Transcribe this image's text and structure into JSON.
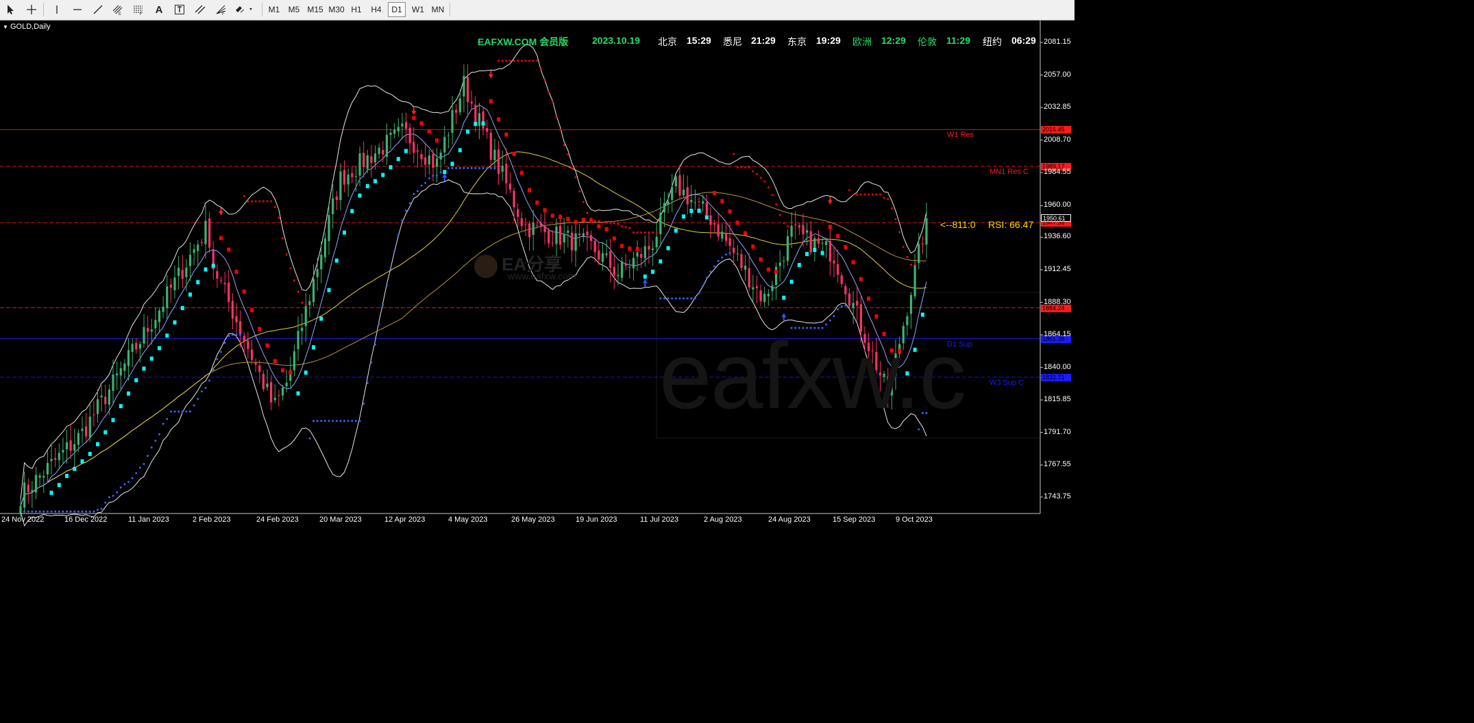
{
  "toolbar": {
    "tools": [
      "cursor-icon",
      "crosshair-icon",
      "vertical-line-icon",
      "horizontal-line-icon",
      "trendline-icon",
      "equidistant-channel-icon",
      "fibonacci-icon",
      "text-icon",
      "text-label-icon",
      "parallel-lines-icon",
      "fibonacci-fan-icon",
      "shapes-icon"
    ],
    "text_tool": "A",
    "timeframes": [
      "M1",
      "M5",
      "M15",
      "M30",
      "H1",
      "H4",
      "D1",
      "W1",
      "MN"
    ],
    "active_timeframe": "D1"
  },
  "chart": {
    "symbol_label": "GOLD,Daily",
    "brand": "EAFXW.COM 会员版",
    "date": "2023.10.19",
    "clocks": [
      {
        "city": "北京",
        "time": "15:29",
        "color": "#ffffff"
      },
      {
        "city": "悉尼",
        "time": "21:29",
        "color": "#ffffff"
      },
      {
        "city": "东京",
        "time": "19:29",
        "color": "#ffffff"
      },
      {
        "city": "欧洲",
        "time": "12:29",
        "color": "#22dd66"
      },
      {
        "city": "伦敦",
        "time": "11:29",
        "color": "#22dd66"
      },
      {
        "city": "纽约",
        "time": "06:29",
        "color": "#ffffff"
      }
    ],
    "watermark_logo": "EA分享",
    "watermark_url": "www.eafxw.com",
    "watermark_big": "eafxw.c",
    "rsi_arrow": "<--811:0",
    "rsi_text": "RSI: 66.47",
    "levels": [
      {
        "name": "W1 Res",
        "price": 2016.45,
        "tag": "2016.45",
        "color": "#ff1a1a",
        "style": "solid"
      },
      {
        "name": "MN1 Res C",
        "price": 1989.17,
        "tag": "1989.17",
        "color": "#ff1a1a",
        "style": "dash"
      },
      {
        "name": "",
        "price": 1947.38,
        "tag": "1947.38",
        "color": "#ff1a1a",
        "style": "dash"
      },
      {
        "name": "",
        "price": 1884.24,
        "tag": "1884.24",
        "color": "#ff1a1a",
        "style": "dash"
      },
      {
        "name": "D1 Sup",
        "price": 1861.38,
        "tag": "1861.38",
        "color": "#1a1aff",
        "style": "solid"
      },
      {
        "name": "W3 Sup C",
        "price": 1832.71,
        "tag": "1832.71",
        "color": "#1a1aff",
        "style": "dash"
      }
    ],
    "current_price_tag": "1950.61",
    "y_ticks": [
      "2081.15",
      "2057.00",
      "2032.85",
      "2008.70",
      "1984.55",
      "1960.00",
      "1936.60",
      "1912.45",
      "1888.30",
      "1864.15",
      "1840.00",
      "1815.85",
      "1791.70",
      "1767.55",
      "1743.75"
    ],
    "x_ticks": [
      "24 Nov 2022",
      "16 Dec 2022",
      "11 Jan 2023",
      "2 Feb 2023",
      "24 Feb 2023",
      "20 Mar 2023",
      "12 Apr 2023",
      "4 May 2023",
      "26 May 2023",
      "19 Jun 2023",
      "11 Jul 2023",
      "2 Aug 2023",
      "24 Aug 2023",
      "15 Sep 2023",
      "9 Oct 2023"
    ],
    "colors": {
      "bull": "#3cb371",
      "bear": "#ff3366",
      "cyan": "#00ffff",
      "red": "#ff0000",
      "blue": "#3366ff",
      "band": "#e8e8e8",
      "ma_yellow": "#e6d23c",
      "ma_slow": "#b8963c",
      "ma_fast": "#8fa8ff"
    }
  },
  "chart_data": {
    "type": "candlestick",
    "symbol": "GOLD",
    "timeframe": "Daily",
    "ylim": [
      1735,
      2090
    ],
    "x_range": [
      "2022-11-24",
      "2023-10-19"
    ],
    "close_path": [
      [
        "2022-11-24",
        1745
      ],
      [
        "2022-12-16",
        1790
      ],
      [
        "2023-01-11",
        1875
      ],
      [
        "2023-01-31",
        1945
      ],
      [
        "2023-02-02",
        1915
      ],
      [
        "2023-02-24",
        1810
      ],
      [
        "2023-03-01",
        1830
      ],
      [
        "2023-03-20",
        1980
      ],
      [
        "2023-04-12",
        2015
      ],
      [
        "2023-04-24",
        1990
      ],
      [
        "2023-05-04",
        2050
      ],
      [
        "2023-05-12",
        2010
      ],
      [
        "2023-05-26",
        1945
      ],
      [
        "2023-06-19",
        1930
      ],
      [
        "2023-06-29",
        1910
      ],
      [
        "2023-07-11",
        1930
      ],
      [
        "2023-07-20",
        1975
      ],
      [
        "2023-08-02",
        1950
      ],
      [
        "2023-08-21",
        1890
      ],
      [
        "2023-08-31",
        1940
      ],
      [
        "2023-09-15",
        1925
      ],
      [
        "2023-10-05",
        1820
      ],
      [
        "2023-10-19",
        1950
      ]
    ],
    "last_price": 1950.61,
    "rsi": 66.47
  }
}
